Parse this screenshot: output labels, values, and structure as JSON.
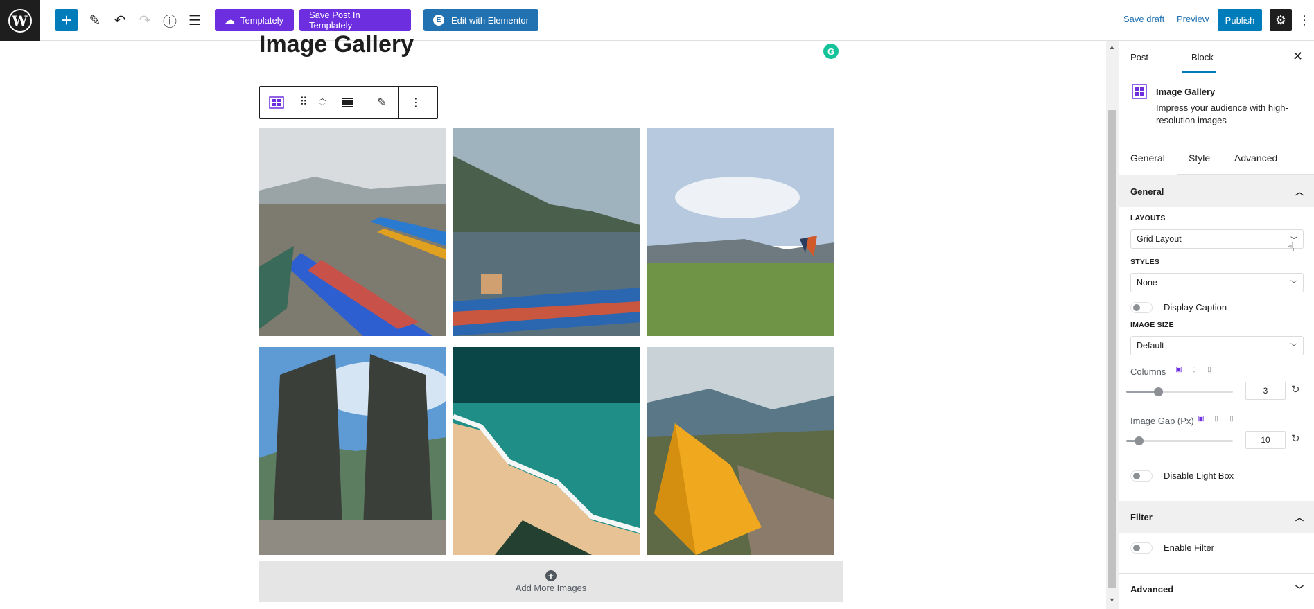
{
  "topbar": {
    "templately_label": "Templately",
    "save_templately_label": "Save Post In Templately",
    "elementor_label": "Edit with Elementor",
    "save_draft": "Save draft",
    "preview": "Preview",
    "publish": "Publish",
    "elementor_badge": "E"
  },
  "editor": {
    "post_title": "Image Gallery",
    "grammarly_badge": "G",
    "add_more_images": "Add More Images",
    "gallery": {
      "columns": 3,
      "images": [
        "lake-boats",
        "lake-boat-mountains",
        "paragliding-field",
        "temple-gate",
        "beach-aerial",
        "yellow-tent"
      ]
    }
  },
  "sidebar": {
    "tabs": [
      "Post",
      "Block"
    ],
    "active_tab": "Block",
    "block_title": "Image Gallery",
    "block_description": "Impress your audience with high-resolution images",
    "panel_tabs": [
      "General",
      "Style",
      "Advanced"
    ],
    "active_panel_tab": "General",
    "general": {
      "title": "General",
      "layouts_label": "LAYOUTS",
      "layout_value": "Grid Layout",
      "styles_label": "STYLES",
      "style_value": "None",
      "display_caption": "Display Caption",
      "display_caption_on": false,
      "image_size_label": "IMAGE SIZE",
      "image_size_value": "Default",
      "columns_label": "Columns",
      "columns_value": "3",
      "columns_fraction": 0.3,
      "gap_label": "Image Gap (Px)",
      "gap_value": "10",
      "gap_fraction": 0.12,
      "disable_lightbox": "Disable Light Box",
      "disable_lightbox_on": false
    },
    "filter": {
      "title": "Filter",
      "enable_filter": "Enable Filter",
      "enable_filter_on": false
    },
    "advanced": {
      "title": "Advanced"
    }
  },
  "colors": {
    "wp_blue": "#007cba",
    "templately_purple": "#6d2ee0",
    "elementor_blue": "#2271b1",
    "grammarly_green": "#15c39a"
  }
}
